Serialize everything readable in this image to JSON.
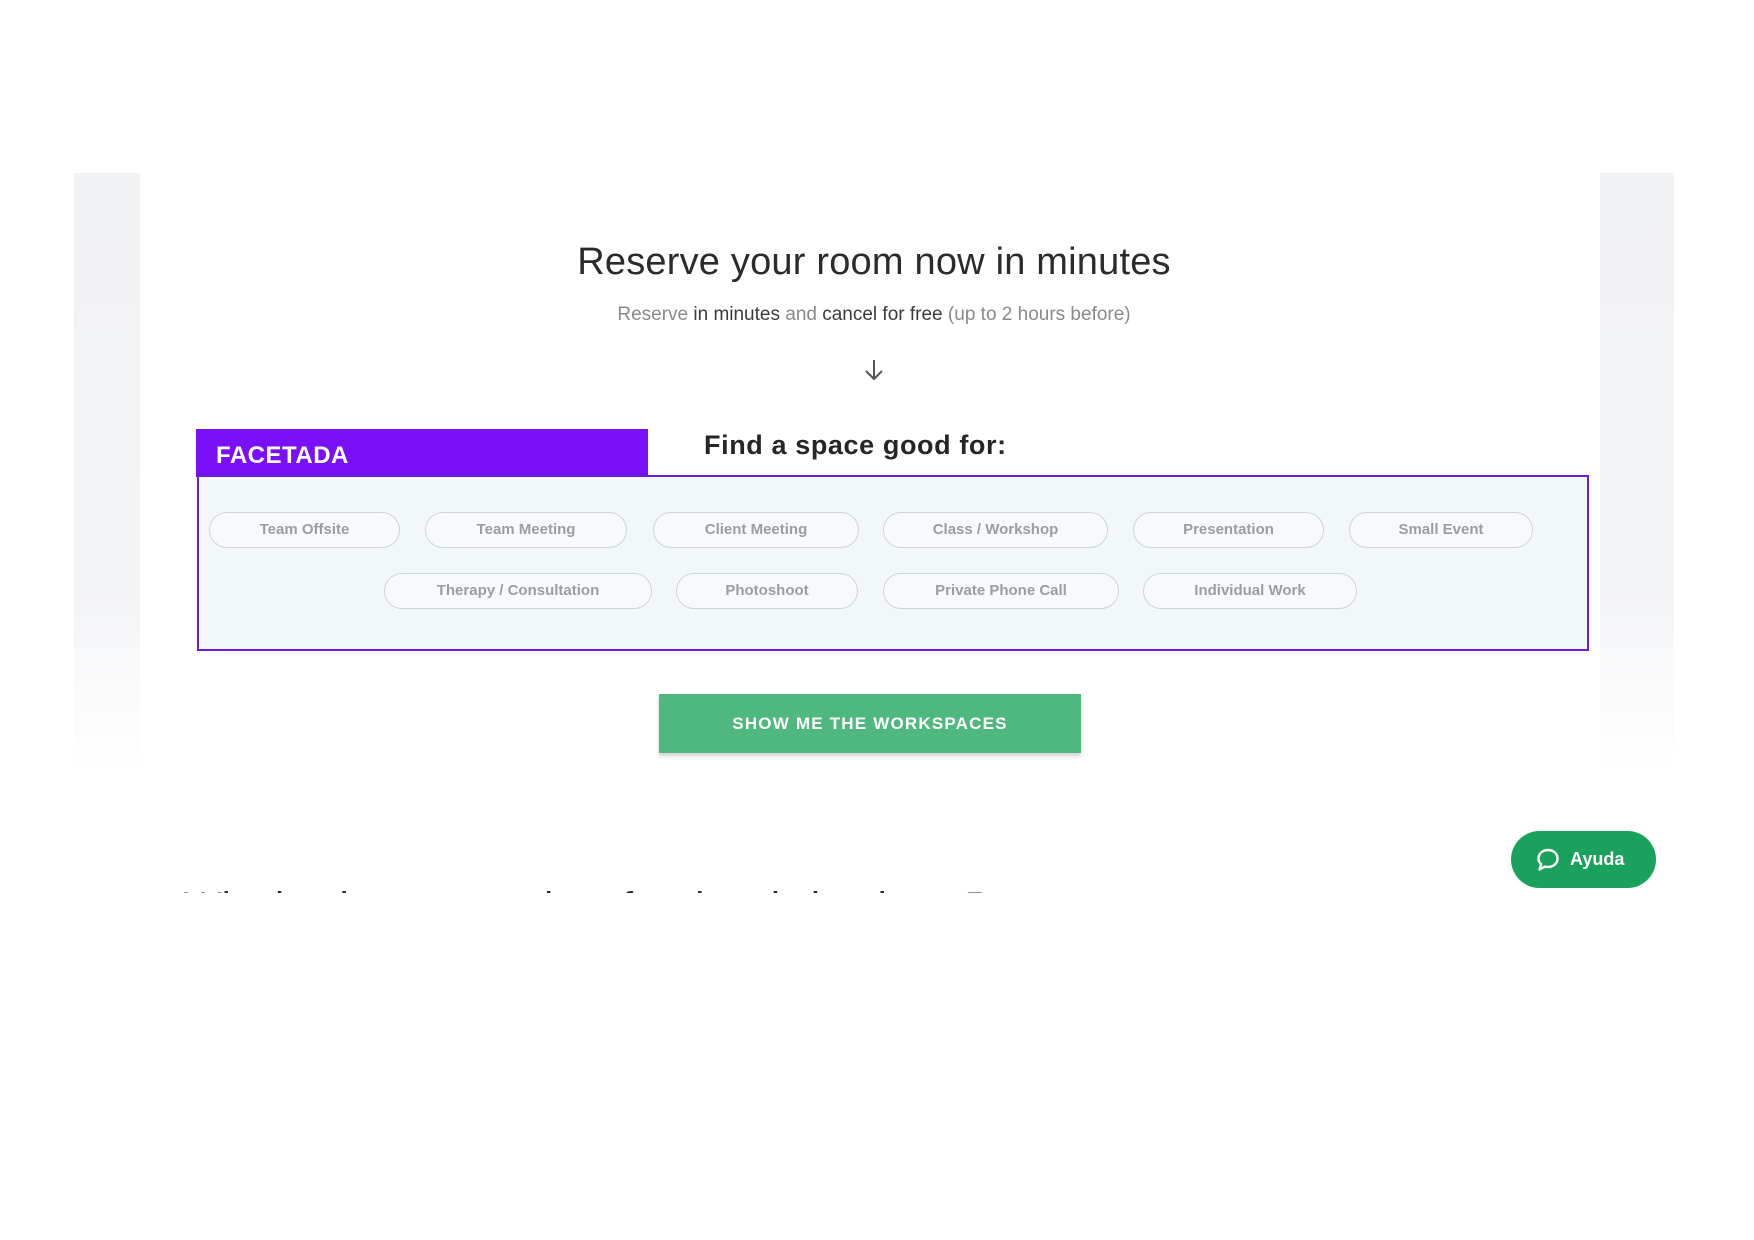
{
  "hero": {
    "title": "Reserve your room now in minutes",
    "subtitle_parts": [
      "Reserve",
      " in minutes",
      " and ",
      "cancel for free",
      " (up to 2 hours before)"
    ]
  },
  "facet_tag": {
    "label": "FACETADA",
    "color": "#7a10f7"
  },
  "finder": {
    "heading": "Find a space good for:",
    "chips_row1": [
      "Team Offsite",
      "Team Meeting",
      "Client Meeting",
      "Class / Workshop",
      "Presentation",
      "Small Event"
    ],
    "chips_row2": [
      "Therapy / Consultation",
      "Photoshoot",
      "Private Phone Call",
      "Individual Work"
    ]
  },
  "cta": {
    "label": "SHOW ME THE WORKSPACES",
    "color": "#4fb87f"
  },
  "help": {
    "label": "Ayuda",
    "icon": "chat-bubble-icon",
    "color": "#1aa15b"
  },
  "next_section": {
    "heading": "Why businesses and professionals book on Peerspace"
  },
  "icons": {
    "scroll_hint": "arrow-down-icon"
  }
}
